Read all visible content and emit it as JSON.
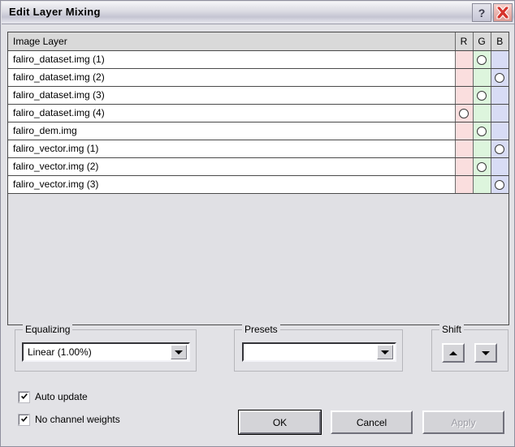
{
  "window": {
    "title": "Edit Layer Mixing",
    "help_button": "?",
    "close_button": "×"
  },
  "table": {
    "columns": [
      "Image Layer",
      "R",
      "G",
      "B"
    ],
    "rows": [
      {
        "name": "faliro_dataset.img (1)",
        "r": false,
        "g": true,
        "b": false
      },
      {
        "name": "faliro_dataset.img (2)",
        "r": false,
        "g": false,
        "b": true
      },
      {
        "name": "faliro_dataset.img (3)",
        "r": false,
        "g": true,
        "b": false
      },
      {
        "name": "faliro_dataset.img (4)",
        "r": true,
        "g": false,
        "b": false
      },
      {
        "name": "faliro_dem.img",
        "r": false,
        "g": true,
        "b": false
      },
      {
        "name": "faliro_vector.img (1)",
        "r": false,
        "g": false,
        "b": true
      },
      {
        "name": "faliro_vector.img (2)",
        "r": false,
        "g": true,
        "b": false
      },
      {
        "name": "faliro_vector.img (3)",
        "r": false,
        "g": false,
        "b": true
      }
    ]
  },
  "equalizing": {
    "group_label": "Equalizing",
    "selected": "Linear (1.00%)"
  },
  "presets": {
    "group_label": "Presets",
    "selected": ""
  },
  "shift": {
    "group_label": "Shift",
    "up_label": "up-arrow",
    "down_label": "down-arrow"
  },
  "options": {
    "auto_update": {
      "label": "Auto update",
      "checked": true
    },
    "no_channel_weights": {
      "label": "No channel weights",
      "checked": true
    }
  },
  "buttons": {
    "ok": "OK",
    "cancel": "Cancel",
    "apply": "Apply"
  },
  "colors": {
    "r_column": "#fadede",
    "g_column": "#ddf5dd",
    "b_column": "#d8dcf5",
    "dialog_bg": "#e2e2e6",
    "header_bg": "#d9d9d9",
    "close_red": "#d6322b"
  }
}
